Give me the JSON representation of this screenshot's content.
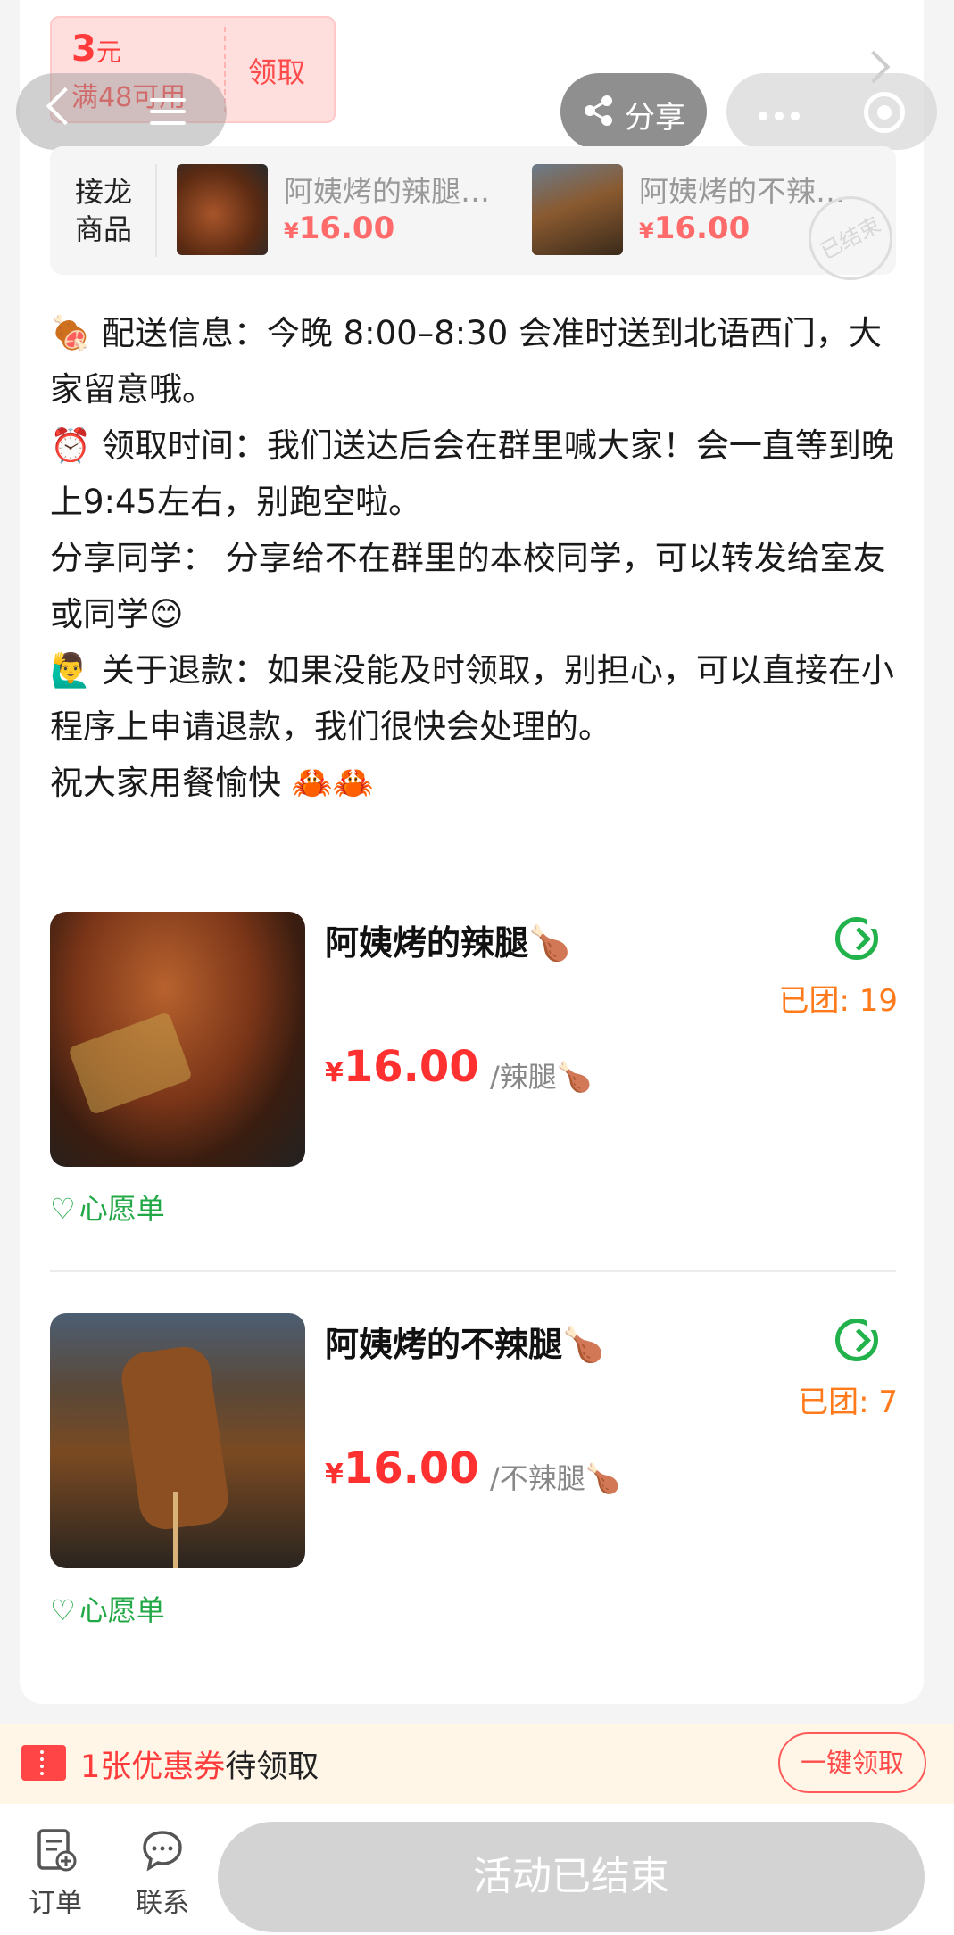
{
  "coupon": {
    "amount": "3",
    "unit": "元",
    "condition": "满48可用",
    "action": "领取"
  },
  "nav": {
    "share_label": "分享"
  },
  "related": {
    "title_line1": "接龙",
    "title_line2": "商品",
    "items": [
      {
        "name": "阿姨烤的辣腿…",
        "currency": "¥",
        "price": "16.00"
      },
      {
        "name": "阿姨烤的不辣…",
        "currency": "¥",
        "price": "16.00"
      }
    ],
    "stamp": "已结束"
  },
  "description": {
    "line1": "🍖 配送信息：今晚 8:00–8:30 会准时送到北语西门，大家留意哦。",
    "line2": "⏰ 领取时间：我们送达后会在群里喊大家！会一直等到晚上9:45左右，别跑空啦。",
    "line3": "分享同学：  分享给不在群里的本校同学，可以转发给室友或同学😊",
    "line4": "🙋‍♂️ 关于退款：如果没能及时领取，别担心，可以直接在小程序上申请退款，我们很快会处理的。",
    "line5": "祝大家用餐愉快 🦀🦀"
  },
  "products": [
    {
      "name": "阿姨烤的辣腿🍗",
      "currency": "¥",
      "price": "16.00",
      "unit": "/辣腿🍗",
      "sold": "已团: 19",
      "wish": "心愿单"
    },
    {
      "name": "阿姨烤的不辣腿🍗",
      "currency": "¥",
      "price": "16.00",
      "unit": "/不辣腿🍗",
      "sold": "已团: 7",
      "wish": "心愿单"
    }
  ],
  "coupon_bar": {
    "count_text": "1张优惠券",
    "suffix": "待领取",
    "button": "一键领取"
  },
  "bottom": {
    "orders_label": "订单",
    "contact_label": "联系",
    "status_button": "活动已结束"
  },
  "colors": {
    "price_red": "#ff3030",
    "accent_green": "#22b24c",
    "sold_orange": "#ff7a1a"
  }
}
